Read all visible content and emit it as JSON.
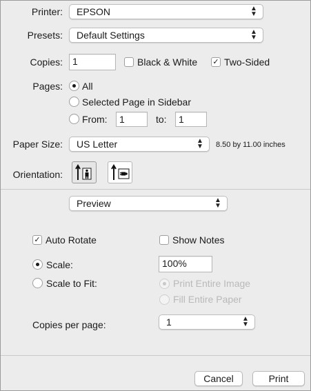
{
  "printer": {
    "label": "Printer:",
    "value": "EPSON"
  },
  "presets": {
    "label": "Presets:",
    "value": "Default Settings"
  },
  "copies": {
    "label": "Copies:",
    "value": "1",
    "black_white_label": "Black & White",
    "black_white_checked": false,
    "two_sided_label": "Two-Sided",
    "two_sided_checked": true
  },
  "pages": {
    "label": "Pages:",
    "all_label": "All",
    "selected_page_label": "Selected Page in Sidebar",
    "from_label": "From:",
    "from_value": "1",
    "to_label": "to:",
    "to_value": "1",
    "selected": "All"
  },
  "paper_size": {
    "label": "Paper Size:",
    "value": "US Letter",
    "dimensions": "8.50 by 11.00 inches"
  },
  "orientation": {
    "label": "Orientation:",
    "selected": "portrait"
  },
  "section_popup": {
    "value": "Preview"
  },
  "preview": {
    "auto_rotate_label": "Auto Rotate",
    "auto_rotate_checked": true,
    "show_notes_label": "Show Notes",
    "show_notes_checked": false,
    "scale_label": "Scale:",
    "scale_value": "100%",
    "scale_to_fit_label": "Scale to Fit:",
    "print_entire_image_label": "Print Entire Image",
    "fill_entire_paper_label": "Fill Entire Paper",
    "copies_per_page_label": "Copies per page:",
    "copies_per_page_value": "1"
  },
  "buttons": {
    "cancel": "Cancel",
    "print": "Print"
  },
  "colors": {
    "background": "#ececec",
    "border": "#9a9a9a",
    "disabled_text": "#b9b9b9"
  }
}
